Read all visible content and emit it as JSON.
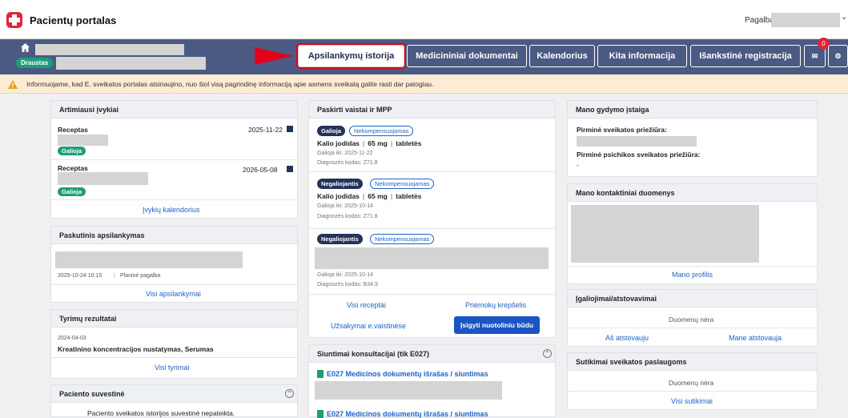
{
  "header": {
    "title": "Pacientų portalas",
    "help_label": "Pagalba"
  },
  "user": {
    "insured_label": "Draustas"
  },
  "nav": {
    "items": [
      "Apsilankymų istorija",
      "Medicininiai dokumentai",
      "Kalendorius",
      "Kita informacija",
      "Išankstinė registracija"
    ],
    "mail_count": "0"
  },
  "alert": "Informuojame, kad E. sveikatos portalas atsinaujino, nuo šiol visą pagrindinę informaciją apie asmens sveikatą galite rasti dar patogiau.",
  "events": {
    "title": "Artimiausi įvykiai",
    "items": [
      {
        "type": "Receptas",
        "date": "2025-11-22",
        "status": "Galioja"
      },
      {
        "type": "Receptas",
        "date": "2026-05-08",
        "status": "Galioja"
      }
    ],
    "link": "Įvykių kalendorius"
  },
  "last_visit": {
    "title": "Paskutinis apsilankymas",
    "datetime": "2025-10-24 10:15",
    "kind": "Planinė pagalba",
    "link": "Visi apsilankymai"
  },
  "results": {
    "title": "Tyrimų rezultatai",
    "date": "2024-04-03",
    "name": "Kreatinino koncentracijos nustatymas, Serumas",
    "link": "Visi tyrimai"
  },
  "summary": {
    "title": "Paciento suvestinė",
    "text": "Paciento sveikatos istorijos suvestinė nepateikta."
  },
  "meds": {
    "title": "Paskirti vaistai ir MPP",
    "items": [
      {
        "status": "Galioja",
        "comp": "Nekompensuojamas",
        "name": "Kalio jodidas",
        "dose": "65 mg",
        "form": "tabletės",
        "valid": "Galioja iki: 2025-11-22",
        "diag": "Diagnozės kodas: Z71.8"
      },
      {
        "status": "Negaliojantis",
        "comp": "Nekompensuojamas",
        "name": "Kalio jodidas",
        "dose": "65 mg",
        "form": "tabletės",
        "valid": "Galioja iki: 2025-10-14",
        "diag": "Diagnozės kodas: Z71.8"
      },
      {
        "status": "Negaliojantis",
        "comp": "Nekompensuojamas",
        "valid": "Galioja iki: 2025-10-14",
        "diag": "Diagnozės kodas: B34.9"
      }
    ],
    "links": {
      "all": "Visi receptai",
      "basket": "Priemokų krepšelis",
      "orders": "Užsakymai e.vaistinėse",
      "buy": "Įsigyti nuotoliniu būdu"
    }
  },
  "referrals": {
    "title": "Siuntimai konsultacijai (tik E027)",
    "item": "E027 Medicinos dokumentų išrašas / siuntimas"
  },
  "institution": {
    "title": "Mano gydymo įstaiga",
    "primary": "Pirminė sveikatos priežiūra:",
    "mental": "Pirminė psichikos sveikatos priežiūra:",
    "mental_value": "-"
  },
  "contacts": {
    "title": "Mano kontaktiniai duomenys",
    "link": "Mano profilis"
  },
  "authorizations": {
    "title": "Įgaliojimai/atstovavimai",
    "empty": "Duomenų nėra",
    "link1": "Aš atstovauju",
    "link2": "Mane atstovauja"
  },
  "consents": {
    "title": "Sutikimai sveikatos paslaugoms",
    "empty": "Duomenų nėra",
    "link": "Visi sutikimai"
  }
}
